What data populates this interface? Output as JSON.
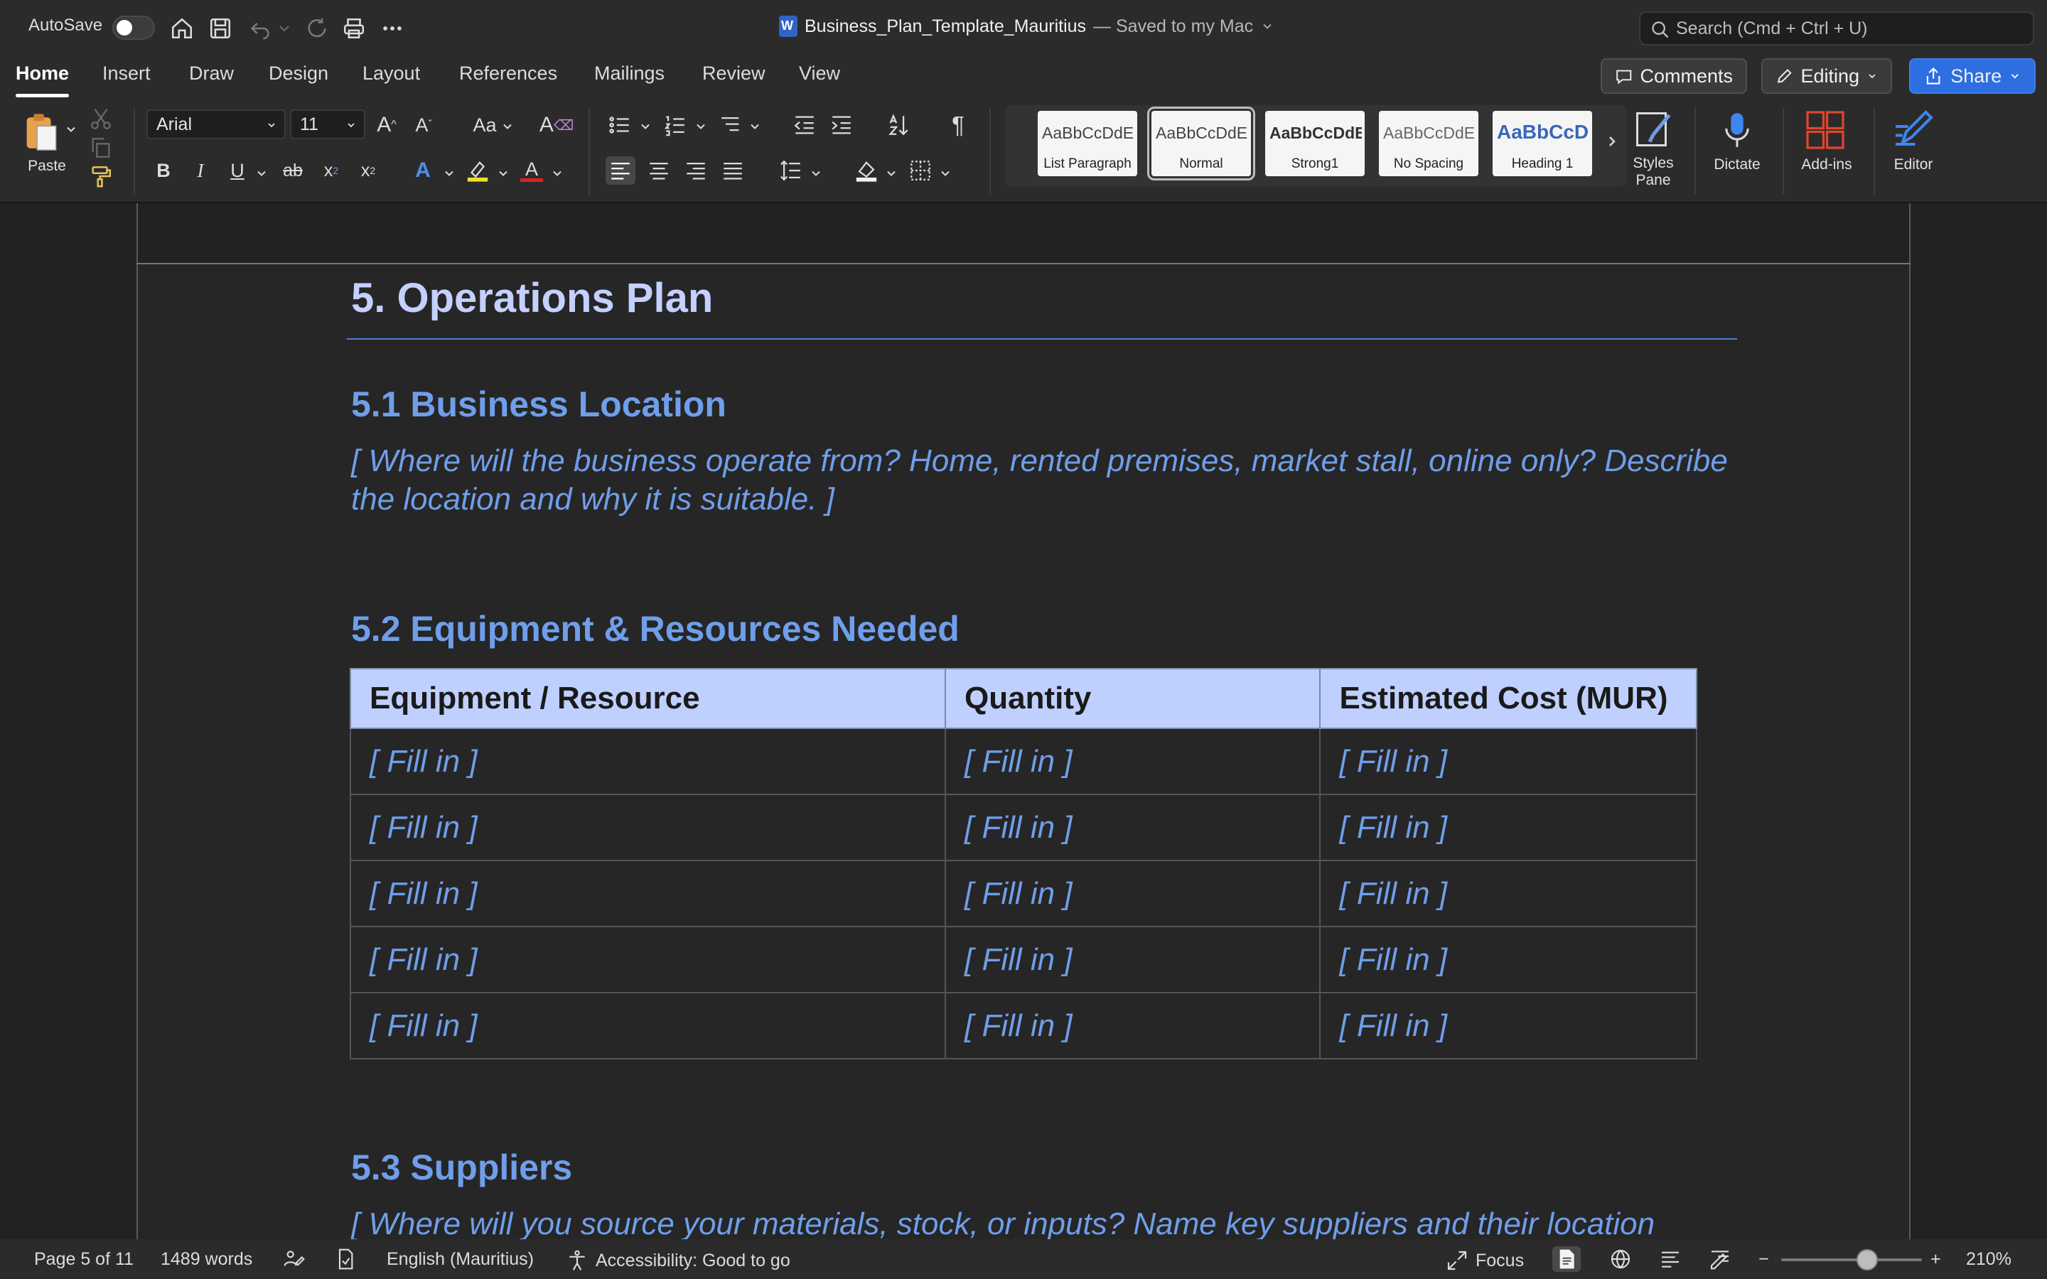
{
  "titlebar": {
    "autosave_label": "AutoSave",
    "doc_name": "Business_Plan_Template_Mauritius",
    "saved_status": "— Saved to my Mac",
    "search_placeholder": "Search (Cmd + Ctrl + U)"
  },
  "tabs": [
    "Home",
    "Insert",
    "Draw",
    "Design",
    "Layout",
    "References",
    "Mailings",
    "Review",
    "View"
  ],
  "top_buttons": {
    "comments": "Comments",
    "editing": "Editing",
    "share": "Share"
  },
  "ribbon": {
    "paste_label": "Paste",
    "font_name": "Arial",
    "font_size": "11",
    "styles": [
      {
        "sample": "AaBbCcDdEe",
        "name": "List Paragraph"
      },
      {
        "sample": "AaBbCcDdEe",
        "name": "Normal"
      },
      {
        "sample": "AaBbCcDdE",
        "name": "Strong1"
      },
      {
        "sample": "AaBbCcDdEe",
        "name": "No Spacing"
      },
      {
        "sample": "AaBbCcD",
        "name": "Heading 1"
      }
    ],
    "styles_pane_label": "Styles Pane",
    "dictate_label": "Dictate",
    "addins_label": "Add-ins",
    "editor_label": "Editor"
  },
  "document": {
    "heading": "5. Operations Plan",
    "section1_title": "5.1 Business Location",
    "section1_text": "[ Where will the business operate from? Home, rented premises, market stall, online only? Describe the location and why it is suitable. ]",
    "section2_title": "5.2 Equipment & Resources Needed",
    "table": {
      "headers": [
        "Equipment / Resource",
        "Quantity",
        "Estimated Cost (MUR)"
      ],
      "rows": [
        [
          "[ Fill in ]",
          "[ Fill in ]",
          "[ Fill in ]"
        ],
        [
          "[ Fill in ]",
          "[ Fill in ]",
          "[ Fill in ]"
        ],
        [
          "[ Fill in ]",
          "[ Fill in ]",
          "[ Fill in ]"
        ],
        [
          "[ Fill in ]",
          "[ Fill in ]",
          "[ Fill in ]"
        ],
        [
          "[ Fill in ]",
          "[ Fill in ]",
          "[ Fill in ]"
        ]
      ]
    },
    "section3_title": "5.3 Suppliers",
    "section3_text": "[ Where will you source your materials, stock, or inputs? Name key suppliers and their location"
  },
  "statusbar": {
    "page": "Page 5 of 11",
    "words": "1489 words",
    "language": "English (Mauritius)",
    "accessibility": "Accessibility: Good to go",
    "focus": "Focus",
    "zoom": "210%",
    "zoom_minus": "−",
    "zoom_plus": "+"
  },
  "colors": {
    "accent_blue": "#6f9eea",
    "share_blue": "#2d6ee0",
    "heading_lavender": "#c4d0ff",
    "table_header_bg": "#bfd0ff"
  }
}
